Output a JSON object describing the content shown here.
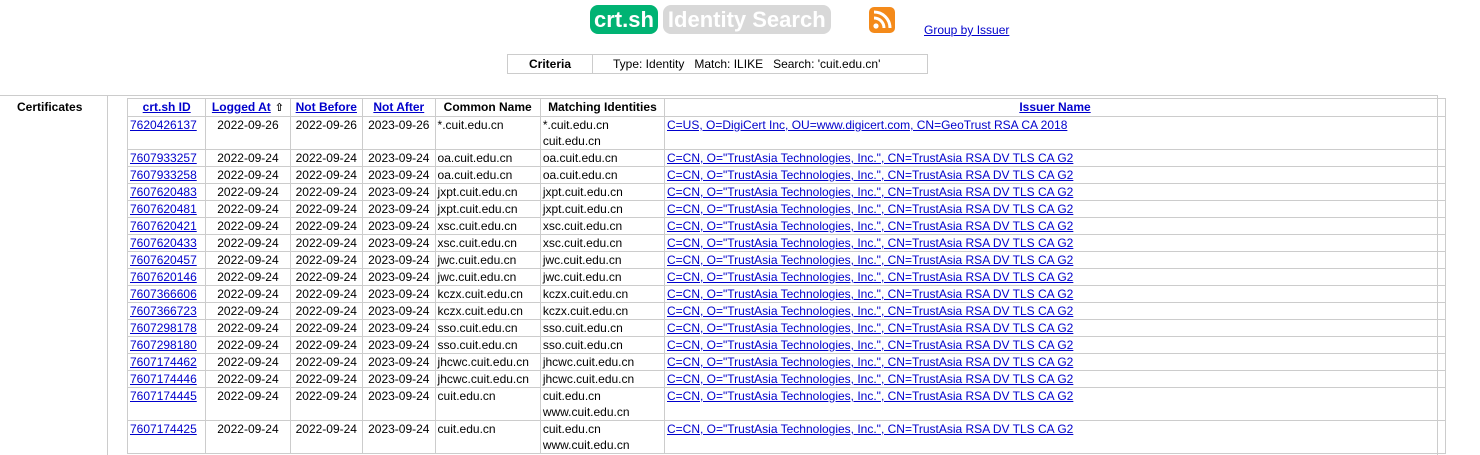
{
  "header": {
    "logo": "crt.sh",
    "page_label": "Identity Search",
    "group_link": "Group by Issuer"
  },
  "criteria": {
    "label": "Criteria",
    "text": "Type: Identity   Match: ILIKE   Search: 'cuit.edu.cn'"
  },
  "certificates": {
    "label": "Certificates",
    "columns": [
      "crt.sh ID",
      "Logged At",
      "Not Before",
      "Not After",
      "Common Name",
      "Matching Identities",
      "Issuer Name"
    ],
    "rows": [
      {
        "id": "7620426137",
        "logged": "2022-09-26",
        "not_before": "2022-09-26",
        "not_after": "2023-09-26",
        "cn": "*.cuit.edu.cn",
        "identities": [
          "*.cuit.edu.cn",
          "cuit.edu.cn"
        ],
        "issuer": "C=US, O=DigiCert Inc, OU=www.digicert.com, CN=GeoTrust RSA CA 2018"
      },
      {
        "id": "7607933257",
        "logged": "2022-09-24",
        "not_before": "2022-09-24",
        "not_after": "2023-09-24",
        "cn": "oa.cuit.edu.cn",
        "identities": [
          "oa.cuit.edu.cn"
        ],
        "issuer": "C=CN, O=\"TrustAsia Technologies, Inc.\", CN=TrustAsia RSA DV TLS CA G2"
      },
      {
        "id": "7607933258",
        "logged": "2022-09-24",
        "not_before": "2022-09-24",
        "not_after": "2023-09-24",
        "cn": "oa.cuit.edu.cn",
        "identities": [
          "oa.cuit.edu.cn"
        ],
        "issuer": "C=CN, O=\"TrustAsia Technologies, Inc.\", CN=TrustAsia RSA DV TLS CA G2"
      },
      {
        "id": "7607620483",
        "logged": "2022-09-24",
        "not_before": "2022-09-24",
        "not_after": "2023-09-24",
        "cn": "jxpt.cuit.edu.cn",
        "identities": [
          "jxpt.cuit.edu.cn"
        ],
        "issuer": "C=CN, O=\"TrustAsia Technologies, Inc.\", CN=TrustAsia RSA DV TLS CA G2"
      },
      {
        "id": "7607620481",
        "logged": "2022-09-24",
        "not_before": "2022-09-24",
        "not_after": "2023-09-24",
        "cn": "jxpt.cuit.edu.cn",
        "identities": [
          "jxpt.cuit.edu.cn"
        ],
        "issuer": "C=CN, O=\"TrustAsia Technologies, Inc.\", CN=TrustAsia RSA DV TLS CA G2"
      },
      {
        "id": "7607620421",
        "logged": "2022-09-24",
        "not_before": "2022-09-24",
        "not_after": "2023-09-24",
        "cn": "xsc.cuit.edu.cn",
        "identities": [
          "xsc.cuit.edu.cn"
        ],
        "issuer": "C=CN, O=\"TrustAsia Technologies, Inc.\", CN=TrustAsia RSA DV TLS CA G2"
      },
      {
        "id": "7607620433",
        "logged": "2022-09-24",
        "not_before": "2022-09-24",
        "not_after": "2023-09-24",
        "cn": "xsc.cuit.edu.cn",
        "identities": [
          "xsc.cuit.edu.cn"
        ],
        "issuer": "C=CN, O=\"TrustAsia Technologies, Inc.\", CN=TrustAsia RSA DV TLS CA G2"
      },
      {
        "id": "7607620457",
        "logged": "2022-09-24",
        "not_before": "2022-09-24",
        "not_after": "2023-09-24",
        "cn": "jwc.cuit.edu.cn",
        "identities": [
          "jwc.cuit.edu.cn"
        ],
        "issuer": "C=CN, O=\"TrustAsia Technologies, Inc.\", CN=TrustAsia RSA DV TLS CA G2"
      },
      {
        "id": "7607620146",
        "logged": "2022-09-24",
        "not_before": "2022-09-24",
        "not_after": "2023-09-24",
        "cn": "jwc.cuit.edu.cn",
        "identities": [
          "jwc.cuit.edu.cn"
        ],
        "issuer": "C=CN, O=\"TrustAsia Technologies, Inc.\", CN=TrustAsia RSA DV TLS CA G2"
      },
      {
        "id": "7607366606",
        "logged": "2022-09-24",
        "not_before": "2022-09-24",
        "not_after": "2023-09-24",
        "cn": "kczx.cuit.edu.cn",
        "identities": [
          "kczx.cuit.edu.cn"
        ],
        "issuer": "C=CN, O=\"TrustAsia Technologies, Inc.\", CN=TrustAsia RSA DV TLS CA G2"
      },
      {
        "id": "7607366723",
        "logged": "2022-09-24",
        "not_before": "2022-09-24",
        "not_after": "2023-09-24",
        "cn": "kczx.cuit.edu.cn",
        "identities": [
          "kczx.cuit.edu.cn"
        ],
        "issuer": "C=CN, O=\"TrustAsia Technologies, Inc.\", CN=TrustAsia RSA DV TLS CA G2"
      },
      {
        "id": "7607298178",
        "logged": "2022-09-24",
        "not_before": "2022-09-24",
        "not_after": "2023-09-24",
        "cn": "sso.cuit.edu.cn",
        "identities": [
          "sso.cuit.edu.cn"
        ],
        "issuer": "C=CN, O=\"TrustAsia Technologies, Inc.\", CN=TrustAsia RSA DV TLS CA G2"
      },
      {
        "id": "7607298180",
        "logged": "2022-09-24",
        "not_before": "2022-09-24",
        "not_after": "2023-09-24",
        "cn": "sso.cuit.edu.cn",
        "identities": [
          "sso.cuit.edu.cn"
        ],
        "issuer": "C=CN, O=\"TrustAsia Technologies, Inc.\", CN=TrustAsia RSA DV TLS CA G2"
      },
      {
        "id": "7607174462",
        "logged": "2022-09-24",
        "not_before": "2022-09-24",
        "not_after": "2023-09-24",
        "cn": "jhcwc.cuit.edu.cn",
        "identities": [
          "jhcwc.cuit.edu.cn"
        ],
        "issuer": "C=CN, O=\"TrustAsia Technologies, Inc.\", CN=TrustAsia RSA DV TLS CA G2"
      },
      {
        "id": "7607174446",
        "logged": "2022-09-24",
        "not_before": "2022-09-24",
        "not_after": "2023-09-24",
        "cn": "jhcwc.cuit.edu.cn",
        "identities": [
          "jhcwc.cuit.edu.cn"
        ],
        "issuer": "C=CN, O=\"TrustAsia Technologies, Inc.\", CN=TrustAsia RSA DV TLS CA G2"
      },
      {
        "id": "7607174445",
        "logged": "2022-09-24",
        "not_before": "2022-09-24",
        "not_after": "2023-09-24",
        "cn": "cuit.edu.cn",
        "identities": [
          "cuit.edu.cn",
          "www.cuit.edu.cn"
        ],
        "issuer": "C=CN, O=\"TrustAsia Technologies, Inc.\", CN=TrustAsia RSA DV TLS CA G2"
      },
      {
        "id": "7607174425",
        "logged": "2022-09-24",
        "not_before": "2022-09-24",
        "not_after": "2023-09-24",
        "cn": "cuit.edu.cn",
        "identities": [
          "cuit.edu.cn",
          "www.cuit.edu.cn"
        ],
        "issuer": "C=CN, O=\"TrustAsia Technologies, Inc.\", CN=TrustAsia RSA DV TLS CA G2"
      }
    ]
  }
}
